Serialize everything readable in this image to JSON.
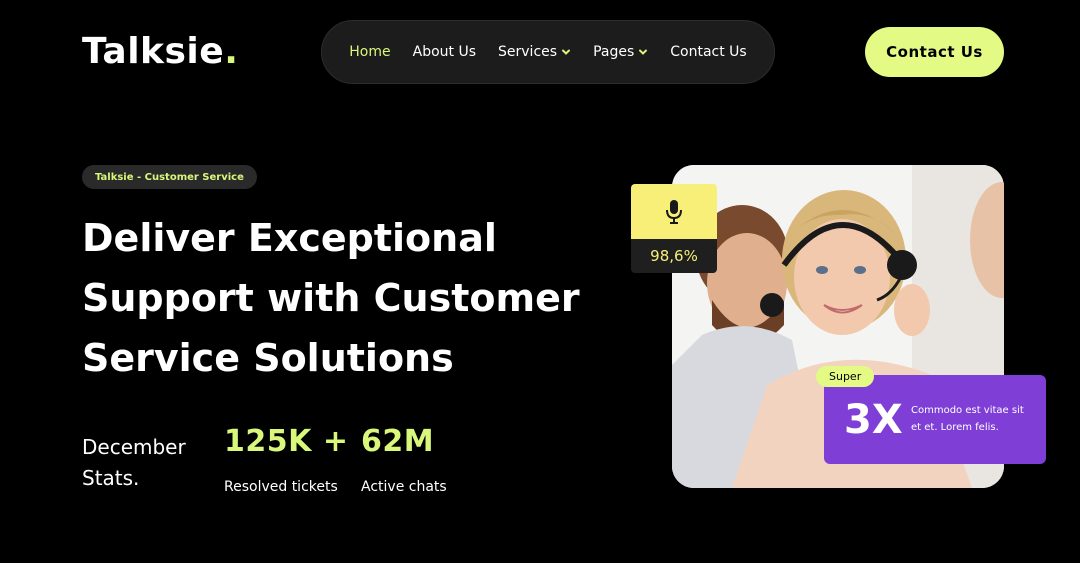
{
  "brand": {
    "name": "Talksie",
    "dot": ".",
    "accent": "#d9f77a"
  },
  "nav": {
    "items": [
      {
        "label": "Home",
        "active": true
      },
      {
        "label": "About Us"
      },
      {
        "label": "Services",
        "dropdown": true
      },
      {
        "label": "Pages",
        "dropdown": true
      },
      {
        "label": "Contact Us"
      }
    ]
  },
  "header_cta": "Contact Us",
  "hero": {
    "eyebrow": "Talksie - Customer Service",
    "headline": [
      "Deliver Exceptional",
      "Support with Customer",
      "Service Solutions"
    ],
    "stats_label": [
      "December",
      "Stats."
    ],
    "stats": [
      {
        "value": "125K +",
        "label": "Resolved tickets"
      },
      {
        "value": "62M",
        "label": "Active chats"
      }
    ]
  },
  "mic_card": {
    "icon": "microphone-icon",
    "value": "98,6%"
  },
  "purple_card": {
    "badge": "Super",
    "value": "3X",
    "text": "Commodo est vitae sit et et. Lorem felis."
  }
}
